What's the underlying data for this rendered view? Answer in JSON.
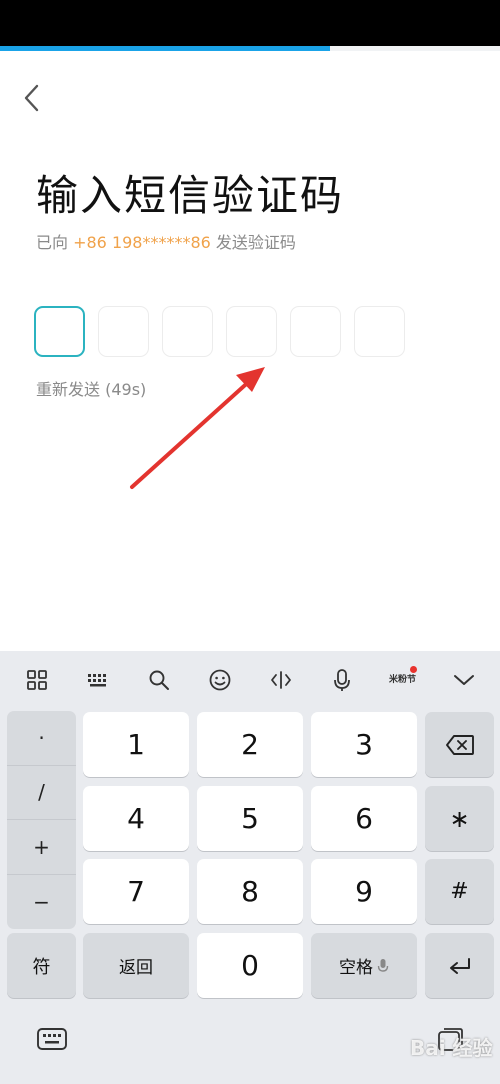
{
  "progress": {
    "fraction": 0.66,
    "color": "#1aa3e8"
  },
  "header": {
    "back_icon": "chevron-left-icon"
  },
  "main": {
    "title": "输入短信验证码",
    "subtitle_prefix": "已向 ",
    "phone": "+86 198******86",
    "subtitle_suffix": " 发送验证码",
    "code_box_count": 6,
    "active_box_index": 0,
    "resend_text": "重新发送 (49s)"
  },
  "keyboard": {
    "toolbar_icons": [
      "grid-icon",
      "keyboard-icon",
      "search-icon",
      "emoji-icon",
      "cursor-icon",
      "microphone-icon",
      "festival-icon",
      "collapse-icon"
    ],
    "festival_label": "米粉节",
    "symbols": [
      "·",
      "/",
      "+",
      "−"
    ],
    "digits": [
      "1",
      "2",
      "3",
      "4",
      "5",
      "6",
      "7",
      "8",
      "9"
    ],
    "right_keys": {
      "star": "∗",
      "hash": "#"
    },
    "fu_label": "符",
    "back_label": "返回",
    "zero_label": "0",
    "space_label": "空格"
  },
  "watermark": "Bai 经验",
  "colors": {
    "accent": "#2bb3c0",
    "phone_orange": "#f0a24a",
    "arrow_red": "#e3342f"
  }
}
